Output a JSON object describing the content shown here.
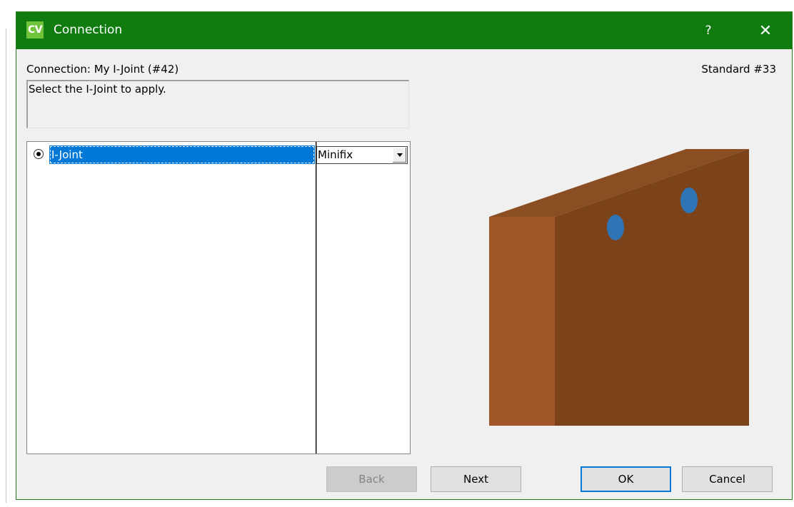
{
  "window": {
    "app_icon_text": "CV",
    "title": "Connection",
    "help_label": "?",
    "close_label": "✕",
    "accent_color": "#107c10"
  },
  "header": {
    "connection_label": "Connection: My I-Joint (#42)",
    "standard_label": "Standard #33"
  },
  "description": {
    "text": "Select the I-Joint to apply."
  },
  "list": {
    "rows": [
      {
        "label": "I-Joint",
        "selected": true,
        "option": "Minifix"
      }
    ]
  },
  "preview": {
    "board_color": "#7c431b",
    "side_color": "#a0572a",
    "top_color": "#8b4d22",
    "hole_color": "#2f75b6",
    "hole_count": 2
  },
  "buttons": {
    "back": "Back",
    "next": "Next",
    "ok": "OK",
    "cancel": "Cancel"
  }
}
